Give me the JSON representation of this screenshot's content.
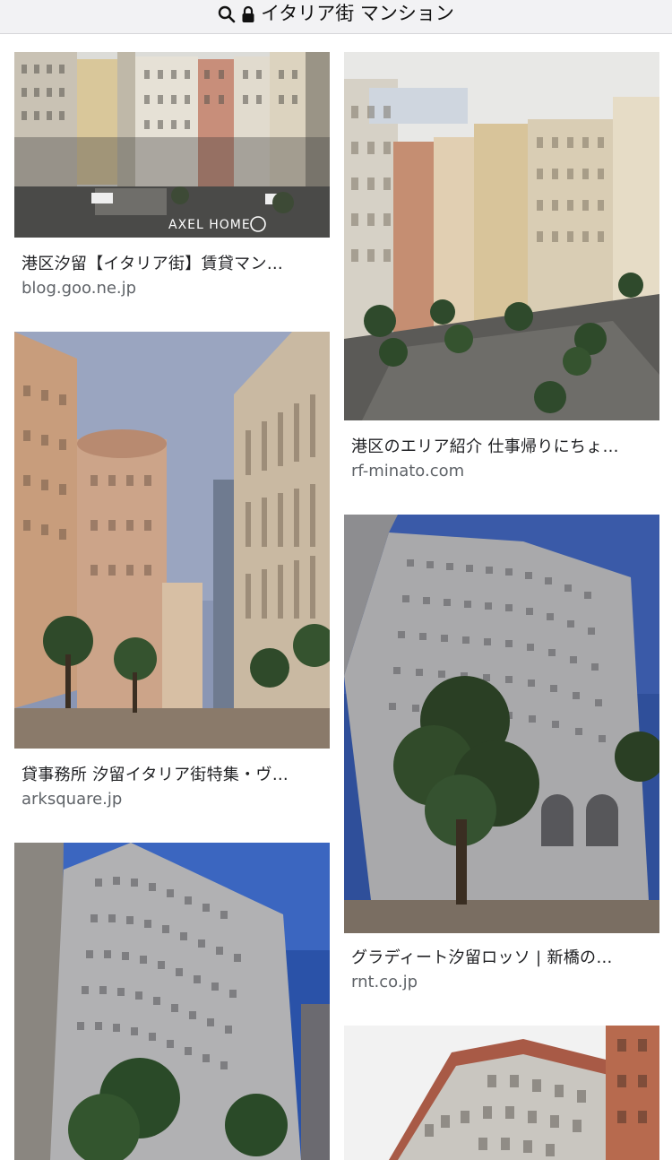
{
  "address_bar": {
    "query": "イタリア街 マンション",
    "search_icon": "search-icon",
    "lock_icon": "lock-icon"
  },
  "results": [
    {
      "title": "港区汐留【イタリア街】賃貸マン…",
      "domain": "blog.goo.ne.jp",
      "watermark": "AXEL HOME"
    },
    {
      "title": "港区のエリア紹介 仕事帰りにちょ…",
      "domain": "rf-minato.com"
    },
    {
      "title": "貸事務所 汐留イタリア街特集・ヴ…",
      "domain": "arksquare.jp"
    },
    {
      "title": "グラディート汐留ロッソ | 新橋の…",
      "domain": "rnt.co.jp"
    }
  ]
}
